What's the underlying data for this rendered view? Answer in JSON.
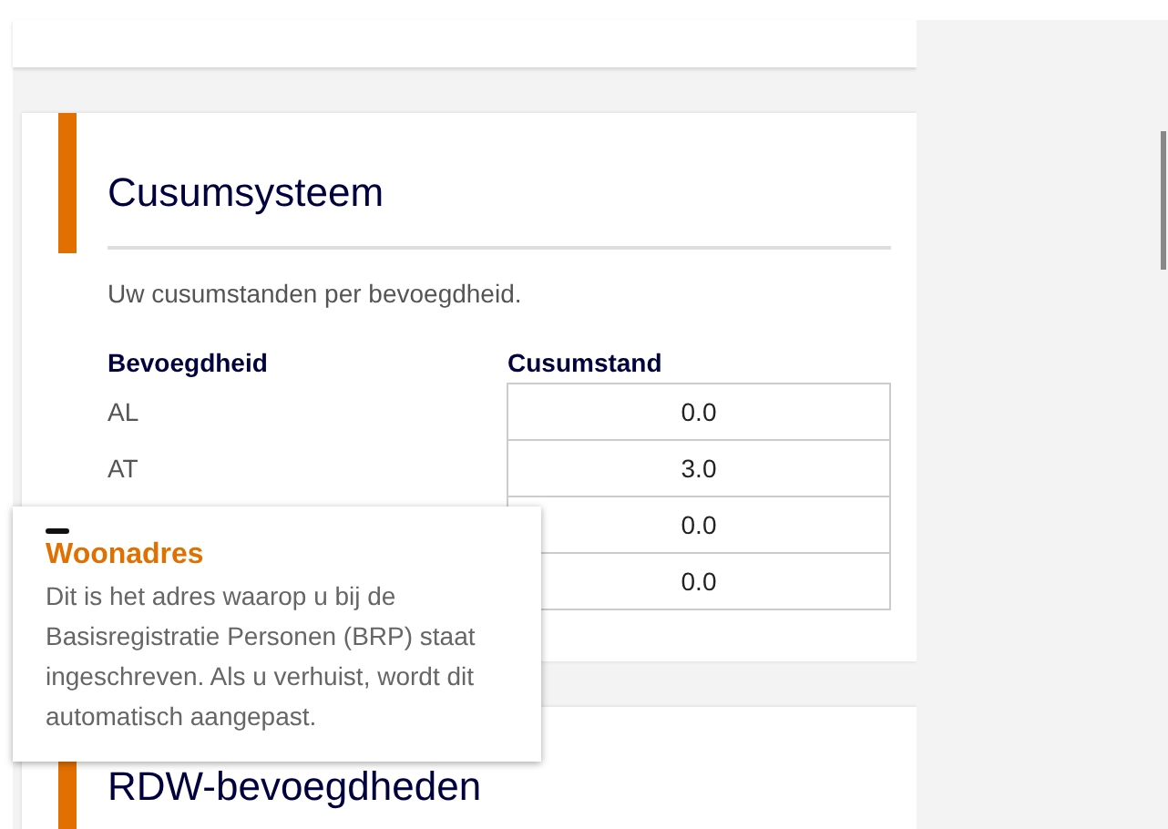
{
  "cards": [
    {
      "title": "Cusumsysteem",
      "intro": "Uw cusumstanden per bevoegdheid.",
      "table": {
        "columns": [
          "Bevoegdheid",
          "Cusumstand"
        ],
        "rows": [
          {
            "name": "AL",
            "value": "0.0"
          },
          {
            "name": "AT",
            "value": "3.0"
          },
          {
            "value": "0.0"
          },
          {
            "value": "0.0"
          }
        ]
      }
    },
    {
      "title": "RDW-bevoegdheden"
    }
  ],
  "tooltip": {
    "title": "Woonadres",
    "text": "Dit is het adres waarop u bij de Basisregistratie Personen (BRP) staat ingeschreven. Als u verhuist, wordt dit automatisch aangepast."
  }
}
